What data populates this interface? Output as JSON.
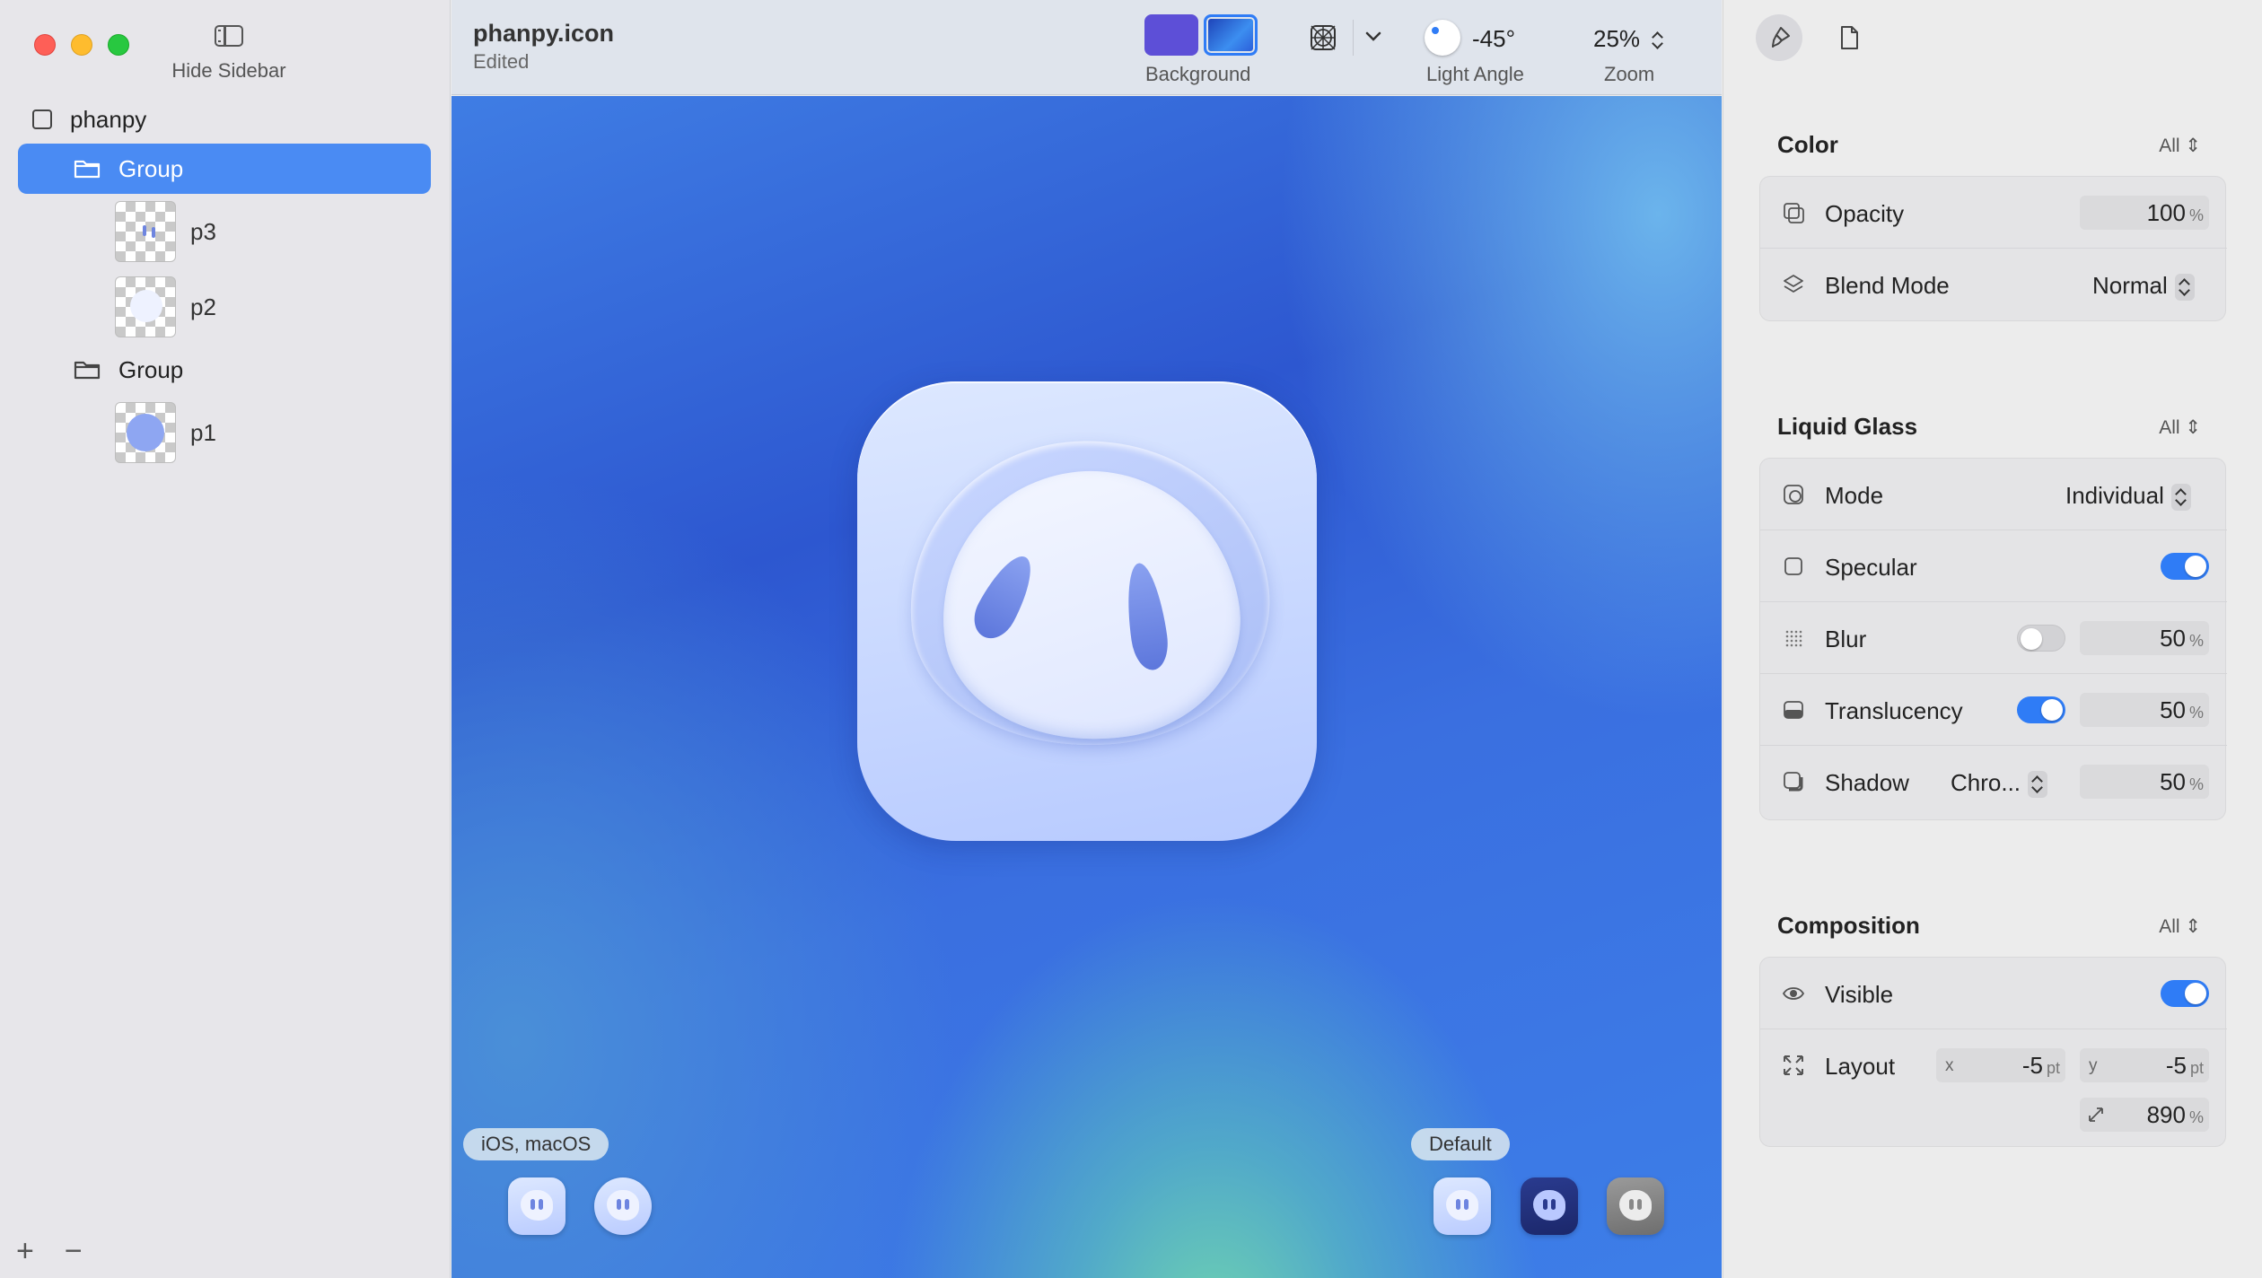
{
  "sidebar": {
    "hide_sidebar_label": "Hide Sidebar",
    "root_label": "phanpy",
    "group1_label": "Group",
    "layer_p3": "p3",
    "layer_p2": "p2",
    "group2_label": "Group",
    "layer_p1": "p1",
    "add_label": "+",
    "remove_label": "−"
  },
  "toolbar": {
    "doc_title": "phanpy.icon",
    "doc_status": "Edited",
    "background_label": "Background",
    "light_angle_value": "-45°",
    "light_angle_label": "Light Angle",
    "zoom_value": "25%",
    "zoom_label": "Zoom",
    "swatch_colors": [
      "#5d4fd7",
      "#2f7cf6"
    ]
  },
  "canvas": {
    "platform_pill": "iOS, macOS",
    "appearance_pill": "Default"
  },
  "inspector": {
    "color": {
      "title": "Color",
      "scope": "All",
      "opacity_label": "Opacity",
      "opacity_value": "100",
      "opacity_unit": "%",
      "blend_label": "Blend Mode",
      "blend_value": "Normal"
    },
    "liquid_glass": {
      "title": "Liquid Glass",
      "scope": "All",
      "mode_label": "Mode",
      "mode_value": "Individual",
      "specular_label": "Specular",
      "specular_on": true,
      "blur_label": "Blur",
      "blur_on": false,
      "blur_value": "50",
      "translucency_label": "Translucency",
      "translucency_on": true,
      "translucency_value": "50",
      "shadow_label": "Shadow",
      "shadow_mode": "Chro...",
      "shadow_value": "50",
      "unit": "%"
    },
    "composition": {
      "title": "Composition",
      "scope": "All",
      "visible_label": "Visible",
      "visible_on": true,
      "layout_label": "Layout",
      "x_axis": "x",
      "x_value": "-5",
      "y_axis": "y",
      "y_value": "-5",
      "pt_unit": "pt",
      "scale_value": "890",
      "scale_unit": "%"
    }
  }
}
